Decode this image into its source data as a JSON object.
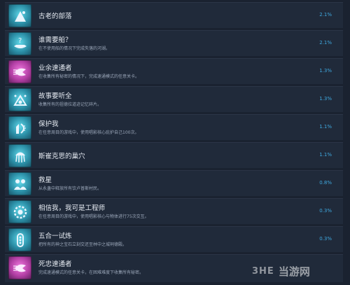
{
  "achievements": [
    {
      "title": "古老的部落",
      "desc": "",
      "percent": "2.1%",
      "icon": "tribe-tent-icon",
      "color": "teal"
    },
    {
      "title": "谁需要船？",
      "desc": "在不使用船的情况下完成失落的河湖。",
      "percent": "2.1%",
      "icon": "boat-question-icon",
      "color": "teal"
    },
    {
      "title": "业余速通者",
      "desc": "在收集所有秘密的情况下，完成速通模式的任意关卡。",
      "percent": "1.3%",
      "icon": "speedrun-bird-icon",
      "color": "pink"
    },
    {
      "title": "故事要听全",
      "desc": "收集所有的祖德拉道迹记忆碎片。",
      "percent": "1.3%",
      "icon": "story-fragments-icon",
      "color": "teal"
    },
    {
      "title": "保护我",
      "desc": "在任意周目的游戏中，使用唱影核心庇护自己100次。",
      "percent": "1.1%",
      "icon": "protect-icon",
      "color": "teal"
    },
    {
      "title": "斯崔克思的巢穴",
      "desc": "",
      "percent": "1.1%",
      "icon": "lair-jellyfish-icon",
      "color": "teal"
    },
    {
      "title": "救星",
      "desc": "从永蛊中释放所有饮卢普斯村民。",
      "percent": "0.8%",
      "icon": "savior-villagers-icon",
      "color": "teal"
    },
    {
      "title": "相信我，我可是工程师",
      "desc": "在任意周目的游戏中，使用唱影核心与物体进行75次交互。",
      "percent": "0.3%",
      "icon": "engineer-gear-icon",
      "color": "teal"
    },
    {
      "title": "五合一试炼",
      "desc": "把所有的神之宝石立刻交还至林中之城祠德殿。",
      "percent": "0.3%",
      "icon": "gem-trial-icon",
      "color": "teal"
    },
    {
      "title": "死忠速通者",
      "desc": "完成速通模式的任意关卡，在困难难度下收集所有秘密。",
      "percent": "",
      "icon": "speedrun-bird-icon",
      "color": "pink"
    }
  ],
  "watermark": {
    "logo": "3HE",
    "text": "当游网"
  }
}
